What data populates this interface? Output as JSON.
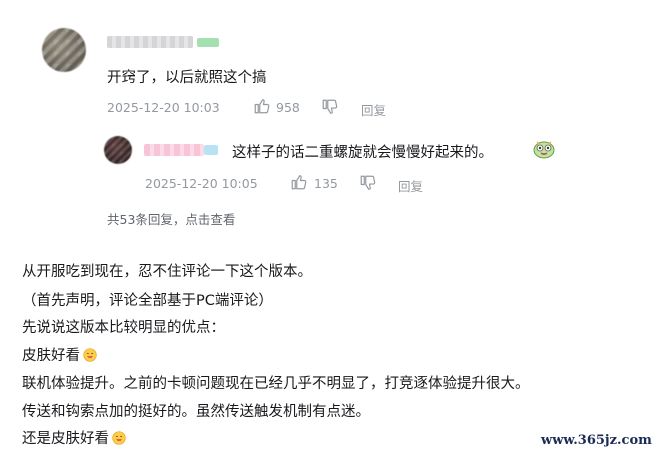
{
  "comment": {
    "text": "开窍了，以后就照这个搞",
    "time": "2025-12-20 10:03",
    "likes": "958",
    "reply_label": "回复"
  },
  "sub_reply": {
    "text": "这样子的话二重螺旋就会慢慢好起来的。",
    "time": "2025-12-20 10:05",
    "likes": "135",
    "reply_label": "回复"
  },
  "more_replies": "共53条回复，点击查看",
  "post": {
    "lines": [
      "从开服吃到现在，忍不住评论一下这个版本。",
      "（首先声明，评论全部基于PC端评论）",
      "先说说这版本比较明显的优点：",
      "皮肤好看",
      "联机体验提升。之前的卡顿问题现在已经几乎不明显了，打竞逐体验提升很大。",
      "传送和钩索点加的挺好的。虽然传送触发机制有点迷。",
      "还是皮肤好看"
    ]
  },
  "watermark": "www.365jz.com",
  "icons": [
    "thumb-up-icon",
    "thumb-down-icon",
    "emoji-sticker-icon",
    "smile-emoji-icon"
  ],
  "colors": {
    "meta": "#9499a0",
    "text": "#18191c",
    "link": "#61666d"
  }
}
